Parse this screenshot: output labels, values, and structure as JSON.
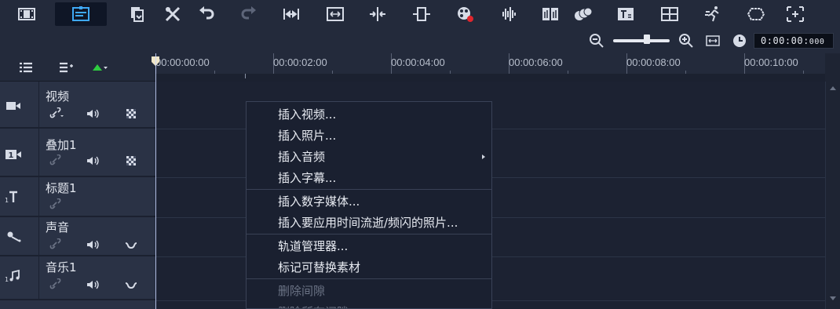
{
  "toolbar": {
    "buttons": [
      {
        "name": "storyboard-view-icon"
      },
      {
        "name": "timeline-view-icon",
        "active": true
      },
      {
        "name": "copy-icon"
      },
      {
        "name": "tools-icon"
      },
      {
        "name": "undo-icon"
      },
      {
        "name": "redo-icon"
      },
      {
        "name": "ripple-edit-icon"
      },
      {
        "name": "fit-project-icon"
      },
      {
        "name": "split-icon"
      },
      {
        "name": "trim-icon"
      },
      {
        "name": "record-capture-icon"
      },
      {
        "name": "sound-mixer-icon"
      },
      {
        "name": "auto-music-icon"
      },
      {
        "name": "motion-tracking-icon"
      },
      {
        "name": "subtitle-editor-icon"
      },
      {
        "name": "multi-camera-icon"
      },
      {
        "name": "speed-icon"
      },
      {
        "name": "mask-icon"
      },
      {
        "name": "pan-zoom-icon"
      }
    ]
  },
  "zoom": {
    "level_fraction": 0.6,
    "timecode": "0:00:00:",
    "timecode_frames": "000"
  },
  "ruler": {
    "labels": [
      "00:00:00:00",
      "00:00:02:00",
      "00:00:04:00",
      "00:00:06:00",
      "00:00:08:00",
      "00:00:10:00"
    ]
  },
  "tracks": [
    {
      "name": "视频",
      "icon": "video-track-icon",
      "controls": [
        "link-icon",
        "volume-icon",
        "grid-icon"
      ]
    },
    {
      "name": "叠加1",
      "icon": "overlay-track-icon",
      "controls": [
        "link-icon",
        "volume-icon",
        "grid-icon"
      ]
    },
    {
      "name": "标题1",
      "icon": "title-track-icon",
      "controls": [
        "link-icon"
      ]
    },
    {
      "name": "声音",
      "icon": "voice-track-icon",
      "controls": [
        "link-icon",
        "volume-icon",
        "ducking-icon"
      ]
    },
    {
      "name": "音乐1",
      "icon": "music-track-icon",
      "controls": [
        "link-icon",
        "volume-icon",
        "ducking-icon"
      ]
    }
  ],
  "context_menu": {
    "items": [
      {
        "label": "插入视频...",
        "disabled": false
      },
      {
        "label": "插入照片...",
        "disabled": false
      },
      {
        "label": "插入音频",
        "disabled": false,
        "submenu": true
      },
      {
        "label": "插入字幕...",
        "disabled": false
      },
      {
        "label": "插入数字媒体...",
        "disabled": false
      },
      {
        "label": "插入要应用时间流逝/频闪的照片...",
        "disabled": false
      },
      {
        "label": "轨道管理器...",
        "disabled": false
      },
      {
        "label": "标记可替换素材",
        "disabled": false
      },
      {
        "label": "删除间隙",
        "disabled": true
      },
      {
        "label": "删除所有间隙",
        "disabled": true
      }
    ]
  },
  "colors": {
    "background": "#1e2433",
    "panel": "#2a3245",
    "accent": "#3fa9f5",
    "record": "#e0262d",
    "add_track": "#2ecc40"
  }
}
